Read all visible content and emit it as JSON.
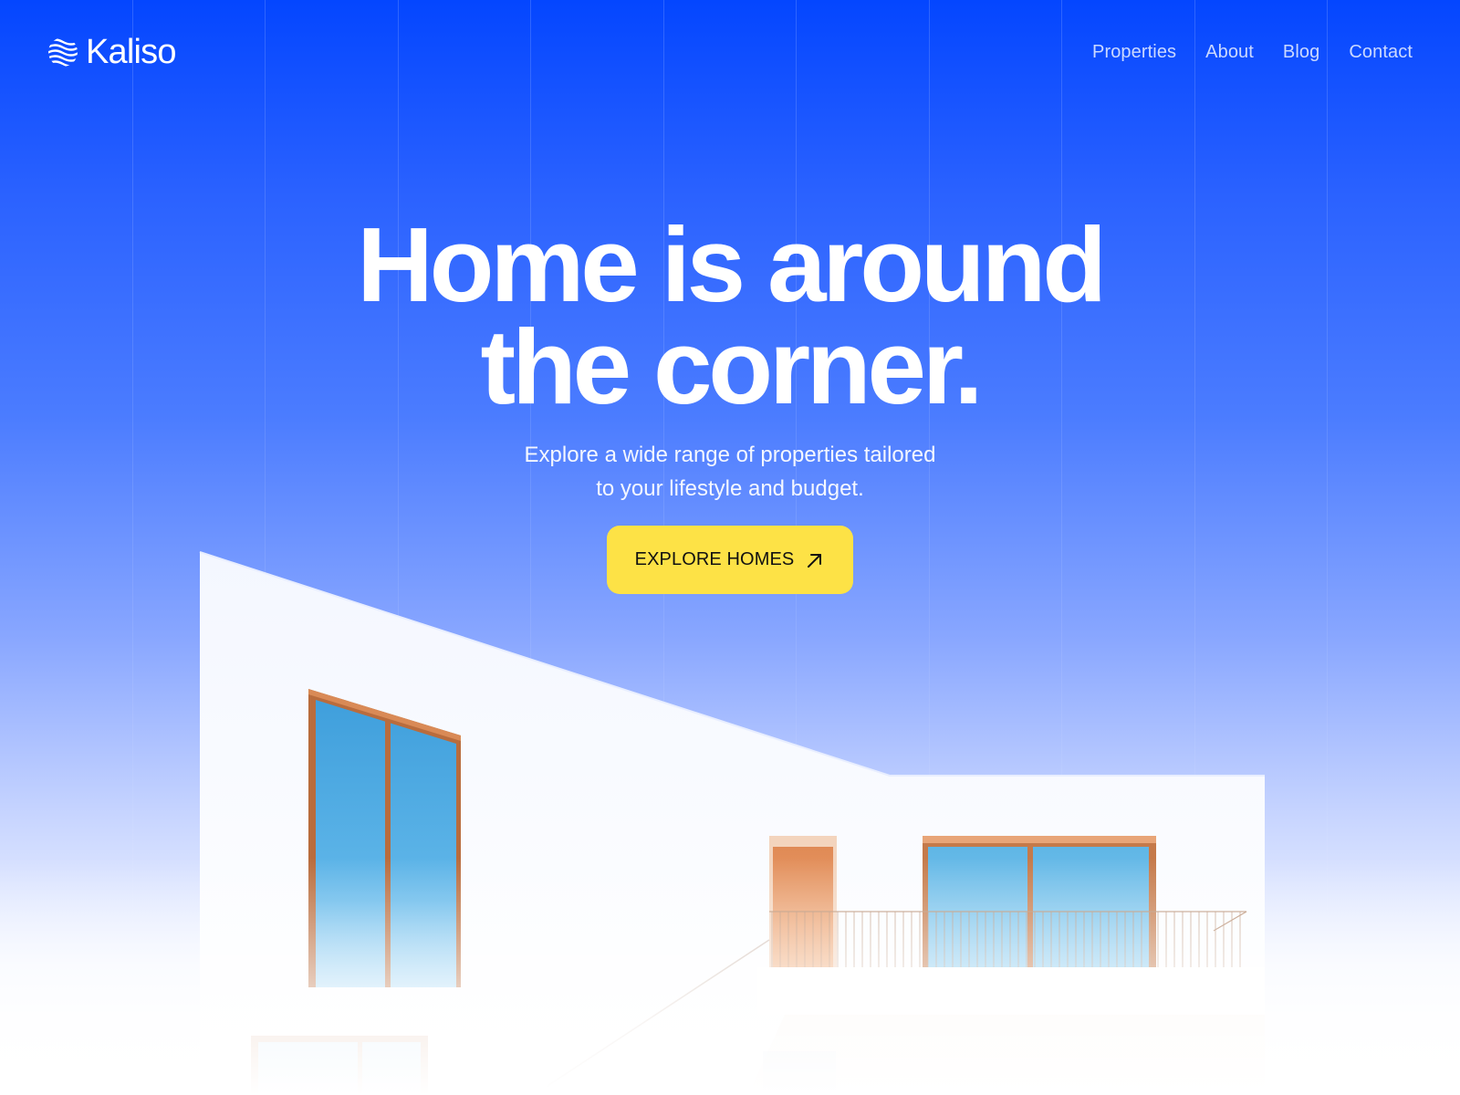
{
  "brand": {
    "name": "Kaliso",
    "logo_icon": "wave-lines-icon"
  },
  "nav": {
    "items": [
      {
        "label": "Properties"
      },
      {
        "label": "About"
      },
      {
        "label": "Blog"
      },
      {
        "label": "Contact"
      }
    ]
  },
  "hero": {
    "title_line1": "Home is around",
    "title_line2": "the corner.",
    "subtitle_line1": "Explore a wide range of properties tailored",
    "subtitle_line2": "to your lifestyle and budget.",
    "cta_label": "EXPLORE HOMES",
    "cta_icon": "arrow-up-right-icon"
  },
  "colors": {
    "sky_top": "#0446ff",
    "cta_background": "#fde246",
    "window_glass": "#4aaee5",
    "window_frame": "#b96c3d"
  }
}
